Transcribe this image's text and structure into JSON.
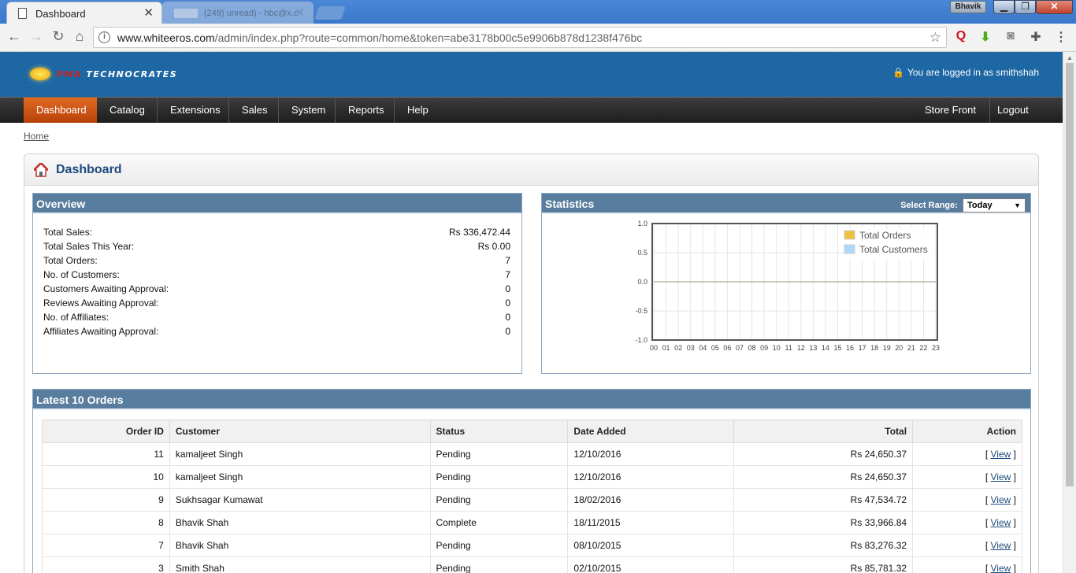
{
  "browser": {
    "active_tab": "Dashboard",
    "background_tab": "(249) unread) - hbc@x.c",
    "url_host": "www.whiteeros.com",
    "url_path": "/admin/index.php?route=common/home&token=abe3178b00c5e9906b878d1238f476bc",
    "profile": "Bhavik"
  },
  "header": {
    "brand_prefix": "PMA",
    "brand_name": "TECHNOCRATES",
    "logged_in_text": "You are logged in as smithshah"
  },
  "menu": {
    "items": [
      "Dashboard",
      "Catalog",
      "Extensions",
      "Sales",
      "System",
      "Reports",
      "Help"
    ],
    "right": [
      "Store Front",
      "Logout"
    ]
  },
  "breadcrumb": "Home",
  "page_title": "Dashboard",
  "overview": {
    "title": "Overview",
    "rows": [
      {
        "label": "Total Sales:",
        "value": "Rs 336,472.44"
      },
      {
        "label": "Total Sales This Year:",
        "value": "Rs 0.00"
      },
      {
        "label": "Total Orders:",
        "value": "7"
      },
      {
        "label": "No. of Customers:",
        "value": "7"
      },
      {
        "label": "Customers Awaiting Approval:",
        "value": "0"
      },
      {
        "label": "Reviews Awaiting Approval:",
        "value": "0"
      },
      {
        "label": "No. of Affiliates:",
        "value": "0"
      },
      {
        "label": "Affiliates Awaiting Approval:",
        "value": "0"
      }
    ]
  },
  "statistics": {
    "title": "Statistics",
    "range_label": "Select Range:",
    "range_value": "Today"
  },
  "chart_data": {
    "type": "line",
    "x": [
      "00",
      "01",
      "02",
      "03",
      "04",
      "05",
      "06",
      "07",
      "08",
      "09",
      "10",
      "11",
      "12",
      "13",
      "14",
      "15",
      "16",
      "17",
      "18",
      "19",
      "20",
      "21",
      "22",
      "23"
    ],
    "yticks": [
      "1.0",
      "0.5",
      "0.0",
      "-0.5",
      "-1.0"
    ],
    "ylim": [
      -1.0,
      1.0
    ],
    "grid": true,
    "legend_position": "top-right",
    "series": [
      {
        "name": "Total Orders",
        "color": "#edc240",
        "values": [
          0,
          0,
          0,
          0,
          0,
          0,
          0,
          0,
          0,
          0,
          0,
          0,
          0,
          0,
          0,
          0,
          0,
          0,
          0,
          0,
          0,
          0,
          0,
          0
        ]
      },
      {
        "name": "Total Customers",
        "color": "#afd8f8",
        "values": [
          0,
          0,
          0,
          0,
          0,
          0,
          0,
          0,
          0,
          0,
          0,
          0,
          0,
          0,
          0,
          0,
          0,
          0,
          0,
          0,
          0,
          0,
          0,
          0
        ]
      }
    ]
  },
  "orders": {
    "title": "Latest 10 Orders",
    "columns": [
      "Order ID",
      "Customer",
      "Status",
      "Date Added",
      "Total",
      "Action"
    ],
    "rows": [
      {
        "id": "11",
        "customer": "kamaljeet Singh",
        "status": "Pending",
        "date": "12/10/2016",
        "total": "Rs 24,650.37"
      },
      {
        "id": "10",
        "customer": "kamaljeet Singh",
        "status": "Pending",
        "date": "12/10/2016",
        "total": "Rs 24,650.37"
      },
      {
        "id": "9",
        "customer": "Sukhsagar Kumawat",
        "status": "Pending",
        "date": "18/02/2016",
        "total": "Rs 47,534.72"
      },
      {
        "id": "8",
        "customer": "Bhavik Shah",
        "status": "Complete",
        "date": "18/11/2015",
        "total": "Rs 33,966.84"
      },
      {
        "id": "7",
        "customer": "Bhavik Shah",
        "status": "Pending",
        "date": "08/10/2015",
        "total": "Rs 83,276.32"
      },
      {
        "id": "3",
        "customer": "Smith Shah",
        "status": "Pending",
        "date": "02/10/2015",
        "total": "Rs 85,781.32"
      }
    ],
    "action_open": "[",
    "action_label": "View",
    "action_close": "]"
  }
}
